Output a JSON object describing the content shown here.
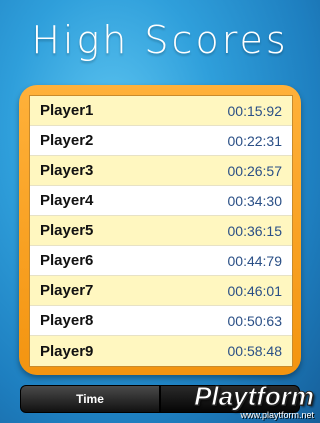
{
  "header": {
    "title": "High Scores"
  },
  "scores": [
    {
      "player": "Player1",
      "time": "00:15:92"
    },
    {
      "player": "Player2",
      "time": "00:22:31"
    },
    {
      "player": "Player3",
      "time": "00:26:57"
    },
    {
      "player": "Player4",
      "time": "00:34:30"
    },
    {
      "player": "Player5",
      "time": "00:36:15"
    },
    {
      "player": "Player6",
      "time": "00:44:79"
    },
    {
      "player": "Player7",
      "time": "00:46:01"
    },
    {
      "player": "Player8",
      "time": "00:50:63"
    },
    {
      "player": "Player9",
      "time": "00:58:48"
    }
  ],
  "tabs": {
    "time_label": "Time",
    "second_label": ""
  },
  "watermark": {
    "logo": "Playtform",
    "url": "www.playtform.net"
  },
  "colors": {
    "background": "#2f9fdb",
    "panel_border": "#f39410",
    "row_highlight": "#fff7c0",
    "time_text": "#2a4f86"
  }
}
